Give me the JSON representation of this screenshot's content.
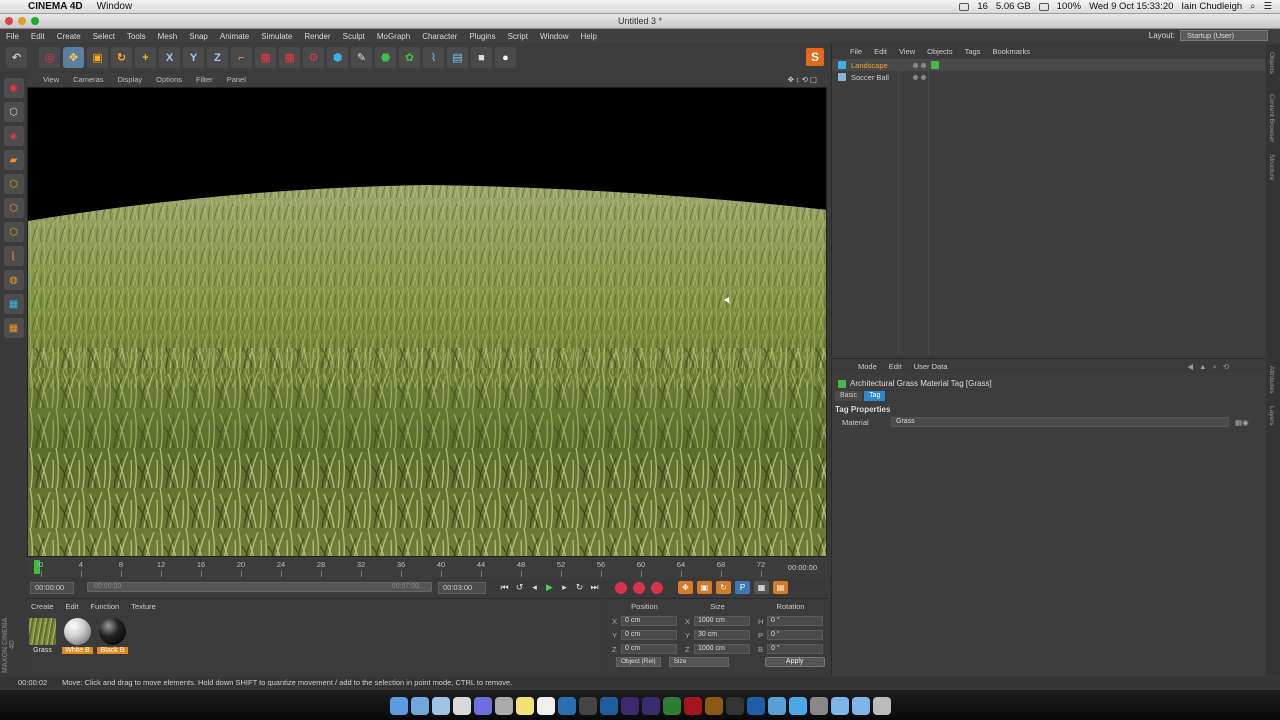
{
  "mac_menubar": {
    "app_name": "CINEMA 4D",
    "menus": [
      "Window"
    ],
    "status": {
      "battery_pct": "100%",
      "clock": "Wed 9 Oct  15:33:20",
      "user": "Iain Chudleigh",
      "mem": "5.06 GB",
      "cpu_count": "16"
    }
  },
  "window": {
    "title": "Untitled 3 *"
  },
  "main_menu": {
    "items": [
      "File",
      "Edit",
      "Create",
      "Select",
      "Tools",
      "Mesh",
      "Snap",
      "Animate",
      "Simulate",
      "Render",
      "Sculpt",
      "MoGraph",
      "Character",
      "Plugins",
      "Script",
      "Window",
      "Help"
    ],
    "layout_label": "Layout:",
    "layout_value": "Startup (User)"
  },
  "viewport_menu": {
    "items": [
      "View",
      "Cameras",
      "Display",
      "Options",
      "Filter",
      "Panel"
    ]
  },
  "timeline": {
    "ticks": [
      "0",
      "4",
      "8",
      "12",
      "16",
      "20",
      "24",
      "28",
      "32",
      "36",
      "40",
      "44",
      "48",
      "52",
      "56",
      "60",
      "64",
      "68",
      "72"
    ],
    "end_time": "00:00:00"
  },
  "transport": {
    "start": "00:00:00",
    "slider_start": "00:00:00",
    "slider_end": "00:07:00",
    "end": "00:03:00"
  },
  "material_manager": {
    "menu": [
      "Create",
      "Edit",
      "Function",
      "Texture"
    ],
    "materials": [
      {
        "name": "Grass",
        "selected": false
      },
      {
        "name": "White B",
        "selected": true
      },
      {
        "name": "Black B",
        "selected": true
      }
    ]
  },
  "coordinates": {
    "headers": [
      "Position",
      "Size",
      "Rotation"
    ],
    "rows": [
      {
        "pos_axis": "X",
        "pos": "0 cm",
        "size_axis": "X",
        "size": "1000 cm",
        "rot_axis": "H",
        "rot": "0 °"
      },
      {
        "pos_axis": "Y",
        "pos": "0 cm",
        "size_axis": "Y",
        "size": "30 cm",
        "rot_axis": "P",
        "rot": "0 °"
      },
      {
        "pos_axis": "Z",
        "pos": "0 cm",
        "size_axis": "Z",
        "size": "1000 cm",
        "rot_axis": "B",
        "rot": "0 °"
      }
    ],
    "mode": "Object (Rel)",
    "size_mode": "Size",
    "apply": "Apply"
  },
  "status_bar": {
    "time": "00:00:02",
    "message": "Move: Click and drag to move elements. Hold down SHIFT to quantize movement / add to the selection in point mode, CTRL to remove."
  },
  "object_manager": {
    "menu": [
      "File",
      "Edit",
      "View",
      "Objects",
      "Tags",
      "Bookmarks"
    ],
    "objects": [
      {
        "name": "Landscape",
        "active": true
      },
      {
        "name": "Soccer Ball",
        "active": false
      }
    ]
  },
  "attribute_manager": {
    "menu": [
      "Mode",
      "Edit",
      "User Data"
    ],
    "title": "Architectural Grass Material Tag [Grass]",
    "tabs": [
      {
        "label": "Basic",
        "on": false
      },
      {
        "label": "Tag",
        "on": true
      }
    ],
    "section": "Tag Properties",
    "field_label": "Material",
    "field_value": "Grass"
  },
  "side_tabs": [
    "Objects",
    "Content Browser",
    "Structure",
    "Attributes",
    "Layers"
  ],
  "toolbar": {
    "x_label": "X",
    "y_label": "Y",
    "z_label": "Z",
    "s_logo": "S",
    "icons": [
      "undo-icon",
      "live-selection-icon",
      "move-icon",
      "scale-icon",
      "rotate-icon",
      "add-icon",
      "x-axis-icon",
      "y-axis-icon",
      "z-axis-icon",
      "world-coord-icon",
      "render-view-icon",
      "render-picture-icon",
      "render-settings-icon",
      "cube-icon",
      "pen-icon",
      "subdivision-icon",
      "array-icon",
      "deformer-icon",
      "floor-icon",
      "camera-icon",
      "light-icon"
    ]
  },
  "maxon_logo": "MAXON CINEMA 4D",
  "colors": {
    "accent_orange": "#e08a1e",
    "tab_blue": "#2f88c9",
    "record_red": "#d7344b",
    "playhead_green": "#3fbf3f"
  }
}
